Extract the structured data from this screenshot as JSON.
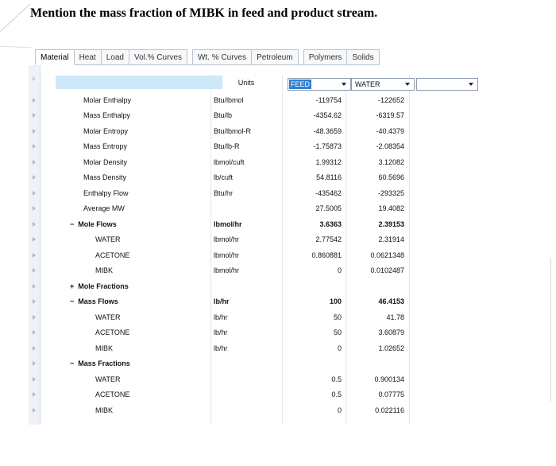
{
  "question": "Mention the mass fraction of MIBK in feed and product stream.",
  "tabs": [
    "Material",
    "Heat",
    "Load",
    "Vol.% Curves",
    "Wt. % Curves",
    "Petroleum",
    "Polymers",
    "Solids"
  ],
  "header": {
    "units": "Units",
    "col1": "FEED",
    "col2": "WATER",
    "col3": ""
  },
  "rows": [
    {
      "label": "Molar Enthalpy",
      "units": "Btu/lbmol",
      "feed": "-119754",
      "water": "-122652"
    },
    {
      "label": "Mass Enthalpy",
      "units": "Btu/lb",
      "feed": "-4354.62",
      "water": "-6319.57"
    },
    {
      "label": "Molar Entropy",
      "units": "Btu/lbmol-R",
      "feed": "-48.3659",
      "water": "-40.4379"
    },
    {
      "label": "Mass Entropy",
      "units": "Btu/lb-R",
      "feed": "-1.75873",
      "water": "-2.08354"
    },
    {
      "label": "Molar Density",
      "units": "lbmol/cuft",
      "feed": "1.99312",
      "water": "3.12082"
    },
    {
      "label": "Mass Density",
      "units": "lb/cuft",
      "feed": "54.8116",
      "water": "60.5696"
    },
    {
      "label": "Enthalpy Flow",
      "units": "Btu/hr",
      "feed": "-435462",
      "water": "-293325"
    },
    {
      "label": "Average MW",
      "units": "",
      "feed": "27.5005",
      "water": "19.4082"
    },
    {
      "label": "Mole Flows",
      "units": "lbmol/hr",
      "feed": "3.6363",
      "water": "2.39153",
      "sign": "−"
    },
    {
      "label": "WATER",
      "units": "lbmol/hr",
      "feed": "2.77542",
      "water": "2.31914"
    },
    {
      "label": "ACETONE",
      "units": "lbmol/hr",
      "feed": "0.860881",
      "water": "0.0621348"
    },
    {
      "label": "MIBK",
      "units": "lbmol/hr",
      "feed": "0",
      "water": "0.0102487"
    },
    {
      "label": "Mole Fractions",
      "units": "",
      "feed": "",
      "water": "",
      "sign": "+"
    },
    {
      "label": "Mass Flows",
      "units": "lb/hr",
      "feed": "100",
      "water": "46.4153",
      "sign": "−"
    },
    {
      "label": "WATER",
      "units": "lb/hr",
      "feed": "50",
      "water": "41.78"
    },
    {
      "label": "ACETONE",
      "units": "lb/hr",
      "feed": "50",
      "water": "3.60879"
    },
    {
      "label": "MIBK",
      "units": "lb/hr",
      "feed": "0",
      "water": "1.02652"
    },
    {
      "label": "Mass Fractions",
      "units": "",
      "feed": "",
      "water": "",
      "sign": "−"
    },
    {
      "label": "WATER",
      "units": "",
      "feed": "0.5",
      "water": "0.900134"
    },
    {
      "label": "ACETONE",
      "units": "",
      "feed": "0.5",
      "water": "0.07775"
    },
    {
      "label": "MIBK",
      "units": "",
      "feed": "0",
      "water": "0.022116"
    }
  ]
}
